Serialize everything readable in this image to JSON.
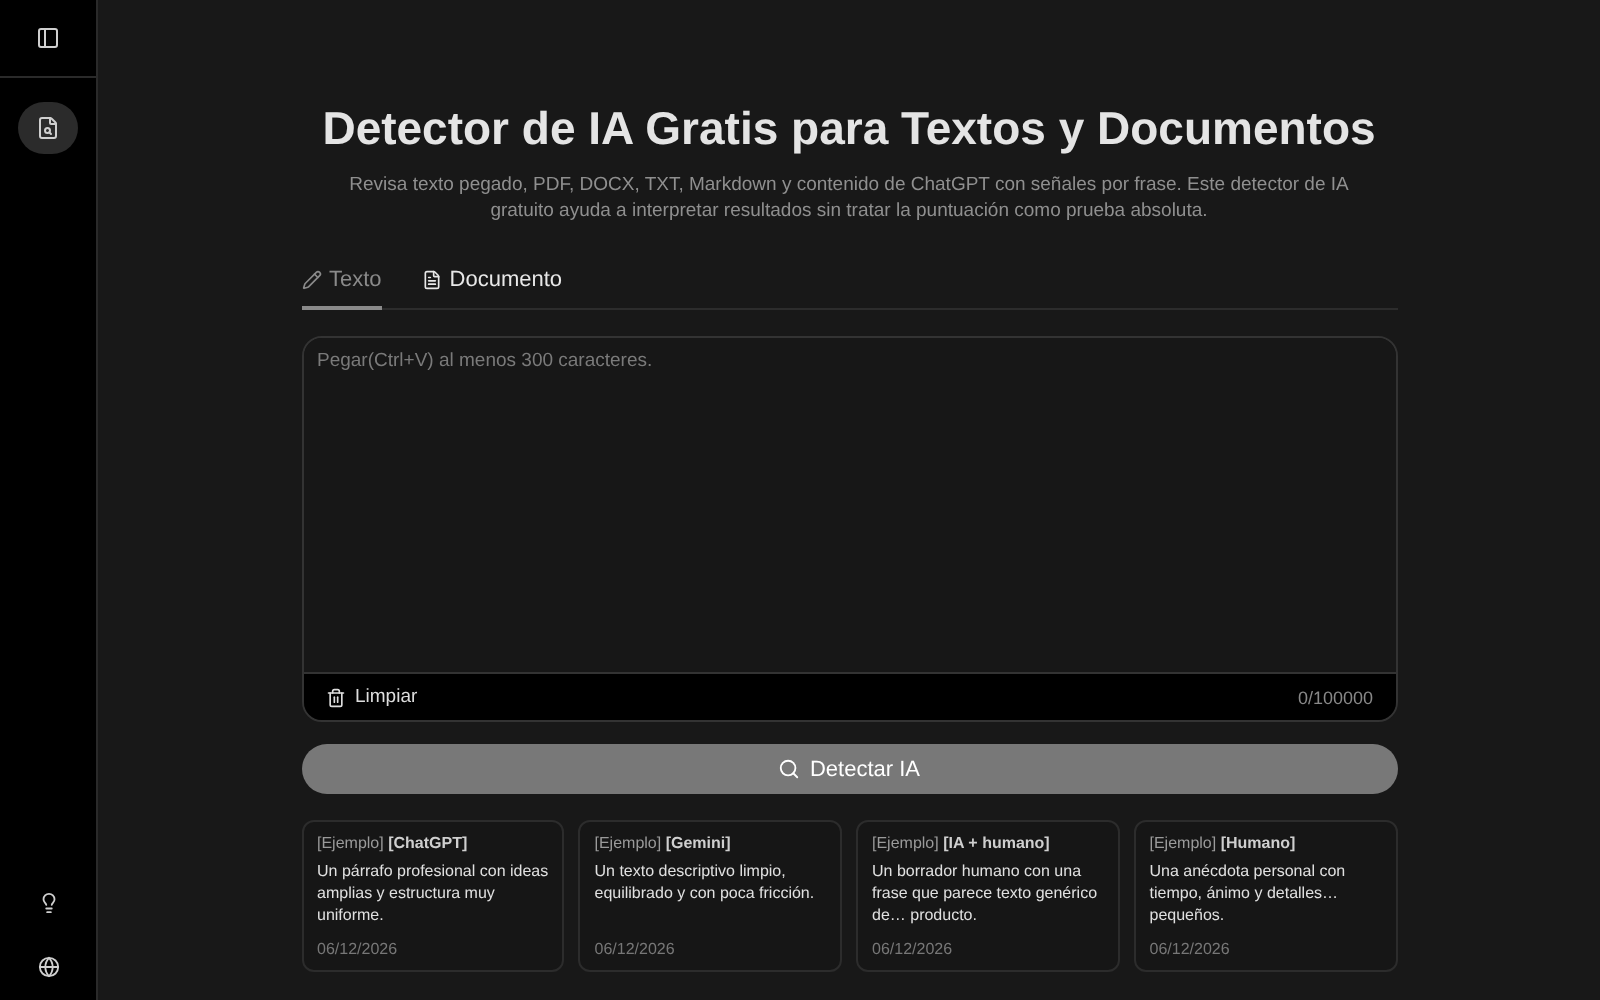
{
  "sidebar": {
    "nav_items": [
      {
        "kind": "detector",
        "selected": true
      }
    ],
    "footer_items": [
      {
        "kind": "tips"
      },
      {
        "kind": "language"
      }
    ]
  },
  "title": "Detector de IA Gratis para Textos y Documentos",
  "subtitle": "Revisa texto pegado, PDF, DOCX, TXT, Markdown y contenido de ChatGPT con señales por frase. Este detector de IA gratuito ayuda a interpretar resultados sin tratar la puntuación como prueba absoluta.",
  "tabs": [
    {
      "label": "Texto",
      "kind": "text",
      "selected": true
    },
    {
      "label": "Documento",
      "kind": "document",
      "selected": false
    }
  ],
  "editor": {
    "placeholder": "Pegar(Ctrl+V) al menos 300 caracteres.",
    "clear_label": "Limpiar",
    "counter": "0/100000"
  },
  "detect_button": "Detectar IA",
  "examples": [
    {
      "tag": "[Ejemplo] **[ChatGPT]**",
      "text": "Un párrafo profesional con ideas amplias y estructura muy uniforme.",
      "date": "06/12/2026"
    },
    {
      "tag": "[Ejemplo] **[Gemini]**",
      "text": "Un texto descriptivo limpio, equilibrado y con poca fricción.",
      "date": "06/12/2026"
    },
    {
      "tag": "[Ejemplo] **[IA + humano]**",
      "text": "Un borrador humano con una frase que parece texto genérico de… producto.",
      "date": "06/12/2026"
    },
    {
      "tag": "[Ejemplo] **[Humano]**",
      "text": "Una anécdota personal con tiempo, ánimo y detalles… pequeños.",
      "date": "06/12/2026"
    }
  ]
}
